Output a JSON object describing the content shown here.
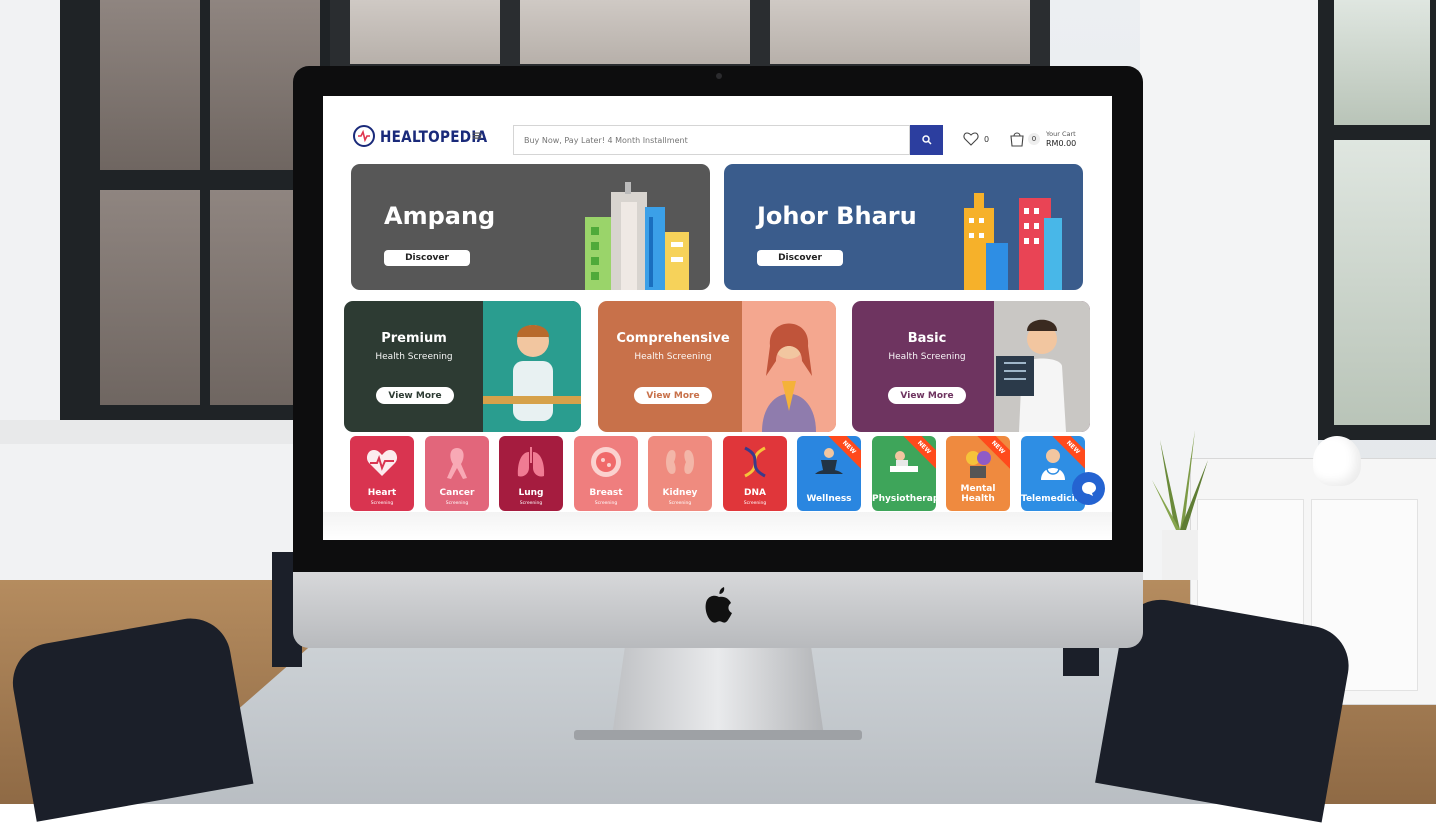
{
  "brand": {
    "name": "HEALTOPEDIA"
  },
  "header": {
    "menu_icon": "hamburger-icon",
    "search_placeholder": "Buy Now, Pay Later! 4 Month Installment",
    "search_icon": "search-icon",
    "wishlist_icon": "heart-icon",
    "wishlist_count": "0",
    "cart_icon": "shopping-bag-icon",
    "cart_count": "0",
    "cart_label": "Your Cart",
    "cart_total": "RM0.00"
  },
  "banners": [
    {
      "title": "Ampang",
      "button": "Discover",
      "color": "#575757"
    },
    {
      "title": "Johor Bharu",
      "button": "Discover",
      "color": "#3a5c8c"
    }
  ],
  "packages": [
    {
      "title": "Premium",
      "subtitle": "Health Screening",
      "button": "View More",
      "color": "#2d3b33"
    },
    {
      "title": "Comprehensive",
      "subtitle": "Health Screening",
      "button": "View More",
      "color": "#c8714a"
    },
    {
      "title": "Basic",
      "subtitle": "Health Screening",
      "button": "View More",
      "color": "#6e3460"
    }
  ],
  "categories": [
    {
      "label": "Heart",
      "sub": "Screening",
      "color": "#d93450",
      "new": false,
      "icon": "heart-icon"
    },
    {
      "label": "Cancer",
      "sub": "Screening",
      "color": "#e2667b",
      "new": false,
      "icon": "ribbon-icon"
    },
    {
      "label": "Lung",
      "sub": "Screening",
      "color": "#a51c3f",
      "new": false,
      "icon": "lungs-icon"
    },
    {
      "label": "Breast",
      "sub": "Screening",
      "color": "#ef7e7e",
      "new": false,
      "icon": "breast-icon"
    },
    {
      "label": "Kidney",
      "sub": "Screening",
      "color": "#ef8b7f",
      "new": false,
      "icon": "kidney-icon"
    },
    {
      "label": "DNA",
      "sub": "Screening",
      "color": "#e0363a",
      "new": false,
      "icon": "dna-icon"
    },
    {
      "label": "Wellness",
      "sub": "",
      "color": "#2a86e0",
      "new": true,
      "icon": "meditation-icon"
    },
    {
      "label": "Physiotherapy",
      "sub": "",
      "color": "#3ea55a",
      "new": true,
      "icon": "physio-icon"
    },
    {
      "label": "Mental Health",
      "sub": "",
      "color": "#ef8a3f",
      "new": true,
      "icon": "mental-health-icon"
    },
    {
      "label": "Telemedicine",
      "sub": "",
      "color": "#2e8ee4",
      "new": true,
      "icon": "doctor-icon"
    }
  ],
  "new_badge": "NEW",
  "chat_icon": "chat-bubble-icon"
}
